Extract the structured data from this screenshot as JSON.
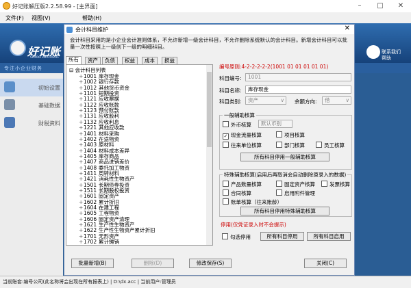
{
  "app": {
    "title": "好记账解压版2.2.58.99 - [主界面]",
    "menu": [
      "文件(F)",
      "视图(V)",
      "帮助(H)"
    ],
    "logo": "好记账",
    "logo_sub": "Good Account",
    "slogan": "专注小企业财务",
    "contact": "联系我们",
    "help": "帮助",
    "sidebar": [
      "初始设置",
      "基础数据",
      "财税资料"
    ],
    "status": "当前账套:编号公司(此名称将会出现在所有报表上) | D:\\dx.acc | 当前用户:管理员"
  },
  "dialog": {
    "title": "会计科目维护",
    "intro": "会计科目采用的是小企业会计准则体系，不允许新增一级会计科目，不允许删除系统默认的会计科目。新增会计科目可以批量一次性按照上一级创下一级的明细科目。",
    "tabs": [
      "所有",
      "资产",
      "负债",
      "权益",
      "成本",
      "损益"
    ],
    "tree_root": "会计科目列表",
    "tree_items": [
      {
        "code": "1001",
        "name": "库存现金"
      },
      {
        "code": "1002",
        "name": "银行存款"
      },
      {
        "code": "1012",
        "name": "其他货币资金"
      },
      {
        "code": "1101",
        "name": "短期投资"
      },
      {
        "code": "1121",
        "name": "应收票据"
      },
      {
        "code": "1122",
        "name": "应收账款"
      },
      {
        "code": "1123",
        "name": "预付账款"
      },
      {
        "code": "1131",
        "name": "应收股利"
      },
      {
        "code": "1132",
        "name": "应收利息"
      },
      {
        "code": "1221",
        "name": "其他应收款"
      },
      {
        "code": "1401",
        "name": "材料采购"
      },
      {
        "code": "1402",
        "name": "在途物资"
      },
      {
        "code": "1403",
        "name": "原材料"
      },
      {
        "code": "1404",
        "name": "材料成本差异"
      },
      {
        "code": "1405",
        "name": "库存商品"
      },
      {
        "code": "1407",
        "name": "商品进销差价"
      },
      {
        "code": "1408",
        "name": "委托加工物资"
      },
      {
        "code": "1411",
        "name": "周转材料"
      },
      {
        "code": "1421",
        "name": "消耗性生物资产"
      },
      {
        "code": "1501",
        "name": "长期债券投资"
      },
      {
        "code": "1511",
        "name": "长期股权投资"
      },
      {
        "code": "1601",
        "name": "固定资产"
      },
      {
        "code": "1602",
        "name": "累计折旧"
      },
      {
        "code": "1604",
        "name": "在建工程"
      },
      {
        "code": "1605",
        "name": "工程物资"
      },
      {
        "code": "1606",
        "name": "固定资产清理"
      },
      {
        "code": "1621",
        "name": "生产性生物资产"
      },
      {
        "code": "1622",
        "name": "生产性生物资产累计折旧"
      },
      {
        "code": "1701",
        "name": "无形资产"
      },
      {
        "code": "1702",
        "name": "累计摊销"
      }
    ],
    "code_rule": "编号原则:4-2-2-2-2-2(1001 01 01 01 01 01)",
    "code_label": "科目编号:",
    "code_value": "1001",
    "name_label": "科目名称:",
    "name_value": "库存现金",
    "type_label": "科目类别:",
    "type_value": "资产",
    "dir_label": "余额方向:",
    "dir_value": "借",
    "aux_group": "一般辅助核算",
    "fx_label": "外币核算",
    "default_currency": "默认币别",
    "aux_checks": [
      {
        "label": "现金流量核算",
        "checked": true
      },
      {
        "label": "项目核算",
        "checked": false
      },
      {
        "label": "往来单位核算",
        "checked": false
      },
      {
        "label": "部门核算",
        "checked": false
      },
      {
        "label": "员工核算",
        "checked": false
      }
    ],
    "disable_aux_btn": "所有科目停用一般辅助核算",
    "special_group": "特殊辅助核算(启用后再取消会自动删除原录入的数据)",
    "special_checks": [
      {
        "label": "产品数量核算",
        "checked": false
      },
      {
        "label": "固定资产核算",
        "checked": false
      },
      {
        "label": "发票核算",
        "checked": false
      },
      {
        "label": "合同核算",
        "checked": false
      },
      {
        "label": "启用附件管理",
        "checked": false
      },
      {
        "label": "账单核算（往来账龄）",
        "checked": false
      }
    ],
    "disable_special_btn": "所有科目停用特殊辅助核算",
    "stop_group": "停用(仅凭证录入时不会提示)",
    "stop_check": "勾选停用",
    "stop_all_btn": "所有科目停用",
    "enable_all_btn": "所有科目启用",
    "buttons": {
      "batch_add": "批量新增(B)",
      "delete": "删除(D)",
      "save": "修改保存(S)",
      "close": "关闭(C)"
    }
  },
  "colors": {
    "accent": "#2a5d94",
    "rule": "#cc0000"
  }
}
